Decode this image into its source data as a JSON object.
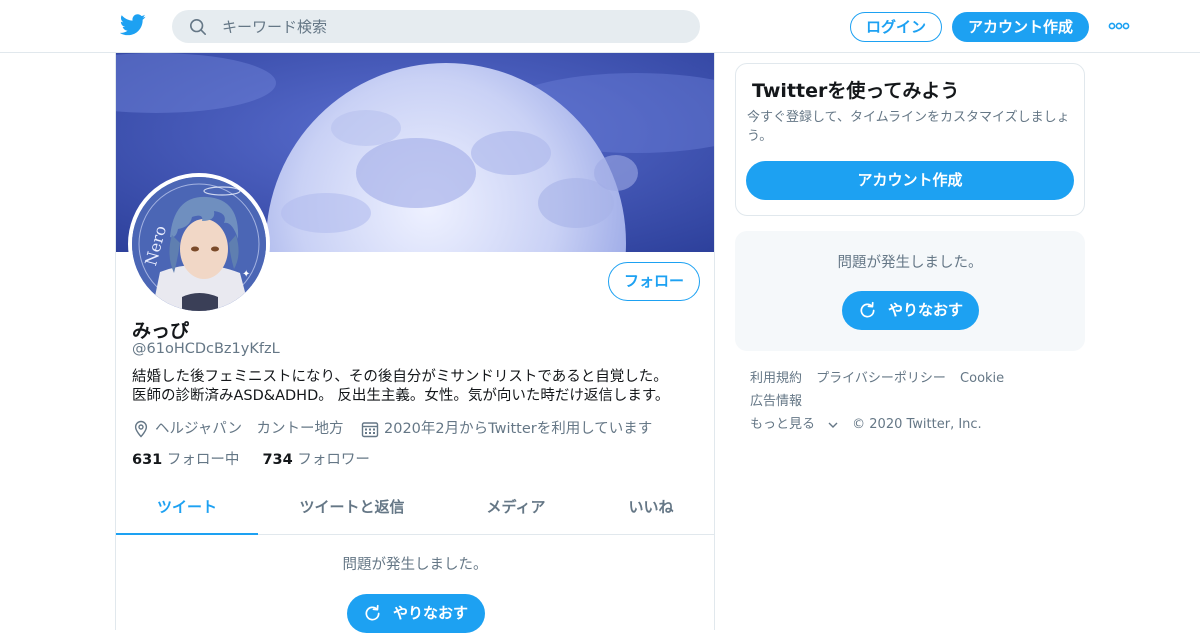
{
  "header": {
    "search_placeholder": "キーワード検索",
    "login_label": "ログイン",
    "signup_label": "アカウント作成"
  },
  "profile": {
    "name": "みっぴ",
    "handle": "@61oHCDcBz1yKfzL",
    "bio_line1": "結婚した後フェミニストになり、その後自分がミサンドリストであると自覚した。",
    "bio_line2": "医師の診断済みASD&ADHD。 反出生主義。女性。気が向いた時だけ返信します。",
    "location": "ヘルジャパン　カントー地方",
    "joined": "2020年2月からTwitterを利用しています",
    "following_count": "631",
    "following_label": "フォロー中",
    "followers_count": "734",
    "followers_label": "フォロワー",
    "follow_button": "フォロー",
    "avatar_text": "Nero"
  },
  "tabs": [
    {
      "label": "ツイート",
      "active": true
    },
    {
      "label": "ツイートと返信",
      "active": false
    },
    {
      "label": "メディア",
      "active": false
    },
    {
      "label": "いいね",
      "active": false
    }
  ],
  "main_error": {
    "message": "問題が発生しました。",
    "retry_label": "やりなおす"
  },
  "signup_card": {
    "title": "Twitterを使ってみよう",
    "description": "今すぐ登録して、タイムラインをカスタマイズしましょう。",
    "button": "アカウント作成"
  },
  "side_error": {
    "message": "問題が発生しました。",
    "retry_label": "やりなおす"
  },
  "footer": {
    "links": [
      "利用規約",
      "プライバシーポリシー",
      "Cookie",
      "広告情報"
    ],
    "more": "もっと見る",
    "copyright": "© 2020 Twitter, Inc."
  },
  "colors": {
    "accent": "#1da1f2",
    "secondary_text": "#657786",
    "border": "#e1e8ed"
  },
  "icons": [
    "twitter-bird-icon",
    "search-icon",
    "more-icon",
    "location-icon",
    "calendar-icon",
    "refresh-icon",
    "chevron-down-icon"
  ]
}
